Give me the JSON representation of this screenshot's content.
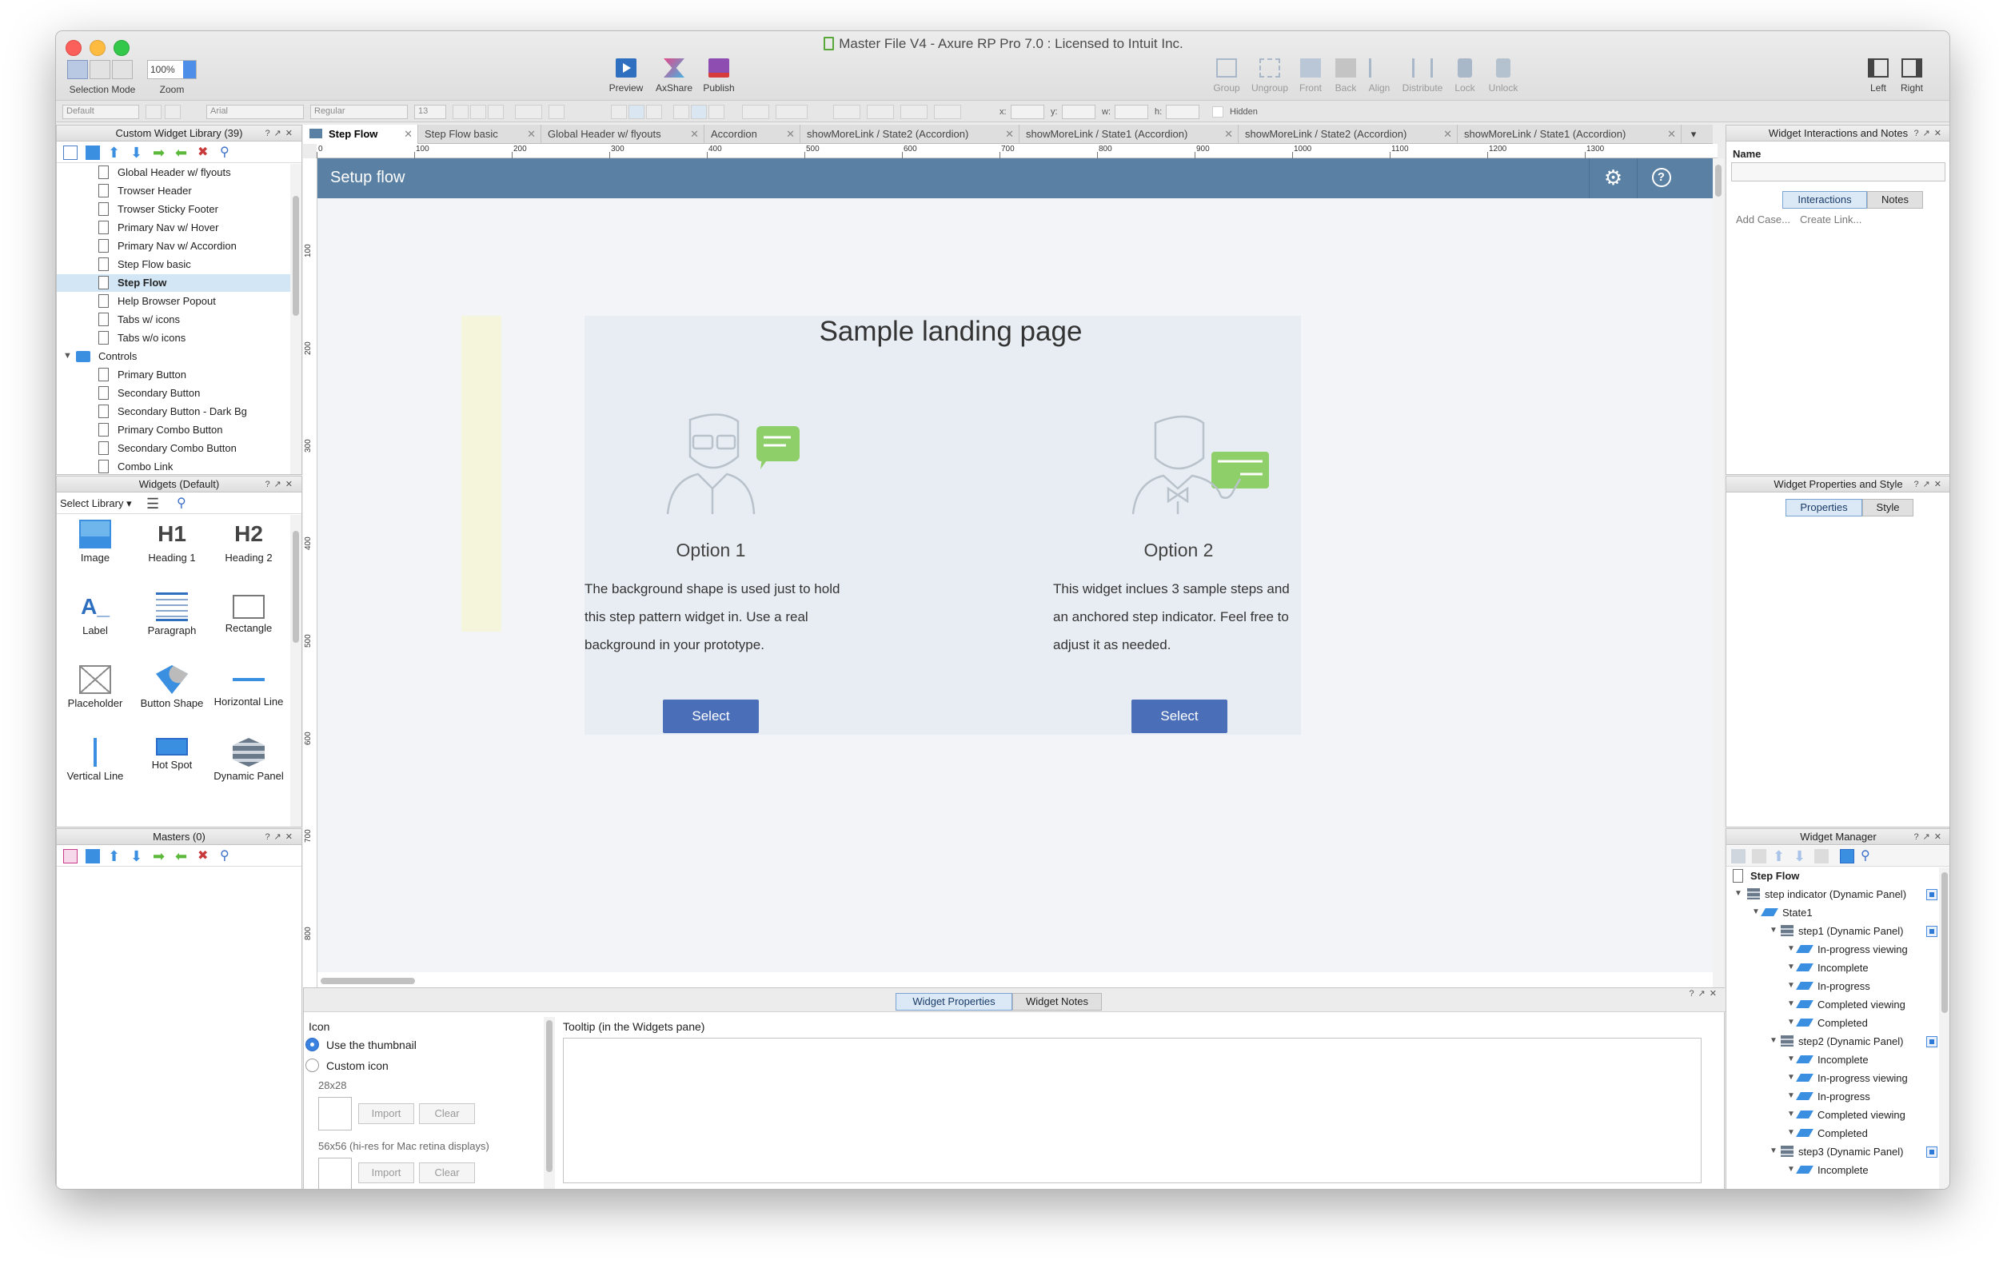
{
  "window": {
    "title": "Master File V4 - Axure RP Pro 7.0 : Licensed to Intuit Inc."
  },
  "toolbar": {
    "zoom_value": "100%",
    "selection_mode_label": "Selection Mode",
    "zoom_label": "Zoom",
    "preview_label": "Preview",
    "axshare_label": "AxShare",
    "publish_label": "Publish",
    "group_label": "Group",
    "ungroup_label": "Ungroup",
    "front_label": "Front",
    "back_label": "Back",
    "align_label": "Align",
    "distribute_label": "Distribute",
    "lock_label": "Lock",
    "unlock_label": "Unlock",
    "left_label": "Left",
    "right_label": "Right"
  },
  "format_bar": {
    "style_value": "Default",
    "font_value": "Arial",
    "weight_value": "Regular",
    "size_value": "13",
    "x_label": "x:",
    "y_label": "y:",
    "w_label": "w:",
    "h_label": "h:",
    "hidden_label": "Hidden"
  },
  "library": {
    "title": "Custom Widget Library (39)",
    "items": [
      "Global Header w/ flyouts",
      "Trowser Header",
      "Trowser Sticky Footer",
      "Primary Nav w/ Hover",
      "Primary Nav w/ Accordion",
      "Step Flow basic",
      "Step Flow",
      "Help Browser Popout",
      "Tabs w/ icons",
      "Tabs w/o icons"
    ],
    "folder": "Controls",
    "controls": [
      "Primary Button",
      "Secondary Button",
      "Secondary Button - Dark Bg",
      "Primary Combo Button",
      "Secondary Combo Button",
      "Combo Link"
    ]
  },
  "widgets_panel": {
    "title": "Widgets (Default)",
    "select_library": "Select Library",
    "items": [
      "Image",
      "Heading 1",
      "Heading 2",
      "Label",
      "Paragraph",
      "Rectangle",
      "Placeholder",
      "Button Shape",
      "Horizontal Line",
      "Vertical Line",
      "Hot Spot",
      "Dynamic Panel"
    ],
    "h1_glyph": "H1",
    "h2_glyph": "H2"
  },
  "masters": {
    "title": "Masters (0)"
  },
  "tabs": [
    "Step Flow",
    "Step Flow basic",
    "Global Header w/ flyouts",
    "Accordion",
    "showMoreLink / State2 (Accordion)",
    "showMoreLink / State1 (Accordion)",
    "showMoreLink / State2 (Accordion)",
    "showMoreLink / State1 (Accordion)"
  ],
  "ruler": {
    "h": [
      "0",
      "100",
      "200",
      "300",
      "400",
      "500",
      "600",
      "700",
      "800",
      "900",
      "1000",
      "1100",
      "1200",
      "1300"
    ],
    "v": [
      "100",
      "200",
      "300",
      "400",
      "500",
      "600",
      "700",
      "800"
    ]
  },
  "canvas": {
    "header_title": "Setup flow",
    "landing_title": "Sample landing page",
    "option1_title": "Option 1",
    "option1_text": "The background shape is used just to hold this step pattern widget in. Use a real background in your prototype.",
    "option2_title": "Option 2",
    "option2_text": "This widget inclues 3 sample steps and an anchored step indicator. Feel free to adjust it as needed.",
    "select_label": "Select"
  },
  "bottom_panel": {
    "tab_properties": "Widget Properties",
    "tab_notes": "Widget Notes",
    "icon_label": "Icon",
    "use_thumbnail": "Use the thumbnail",
    "custom_icon": "Custom icon",
    "size_28": "28x28",
    "size_56": "56x56 (hi-res for Mac retina displays)",
    "import_label": "Import",
    "clear_label": "Clear",
    "tooltip_label": "Tooltip (in the Widgets pane)"
  },
  "interactions_panel": {
    "title": "Widget Interactions and Notes",
    "name_label": "Name",
    "tab_interactions": "Interactions",
    "tab_notes": "Notes",
    "add_case": "Add Case...",
    "create_link": "Create Link..."
  },
  "properties_panel": {
    "title": "Widget Properties and Style",
    "tab_properties": "Properties",
    "tab_style": "Style"
  },
  "widget_manager": {
    "title": "Widget Manager",
    "root": "Step Flow",
    "rows": [
      "step indicator (Dynamic Panel)",
      "State1",
      "step1 (Dynamic Panel)",
      "In-progress viewing",
      "Incomplete",
      "In-progress",
      "Completed viewing",
      "Completed",
      "step2 (Dynamic Panel)",
      "Incomplete",
      "In-progress viewing",
      "In-progress",
      "Completed viewing",
      "Completed",
      "step3 (Dynamic Panel)",
      "Incomplete"
    ]
  },
  "colors": {
    "header_bar": "#5a80a3",
    "button_blue": "#4a6fb8",
    "card_bg": "#e8edf3",
    "yellow_panel": "#f5f5dc",
    "illustration_green": "#8fcf6a",
    "selection_blue": "#d3e6f5"
  }
}
